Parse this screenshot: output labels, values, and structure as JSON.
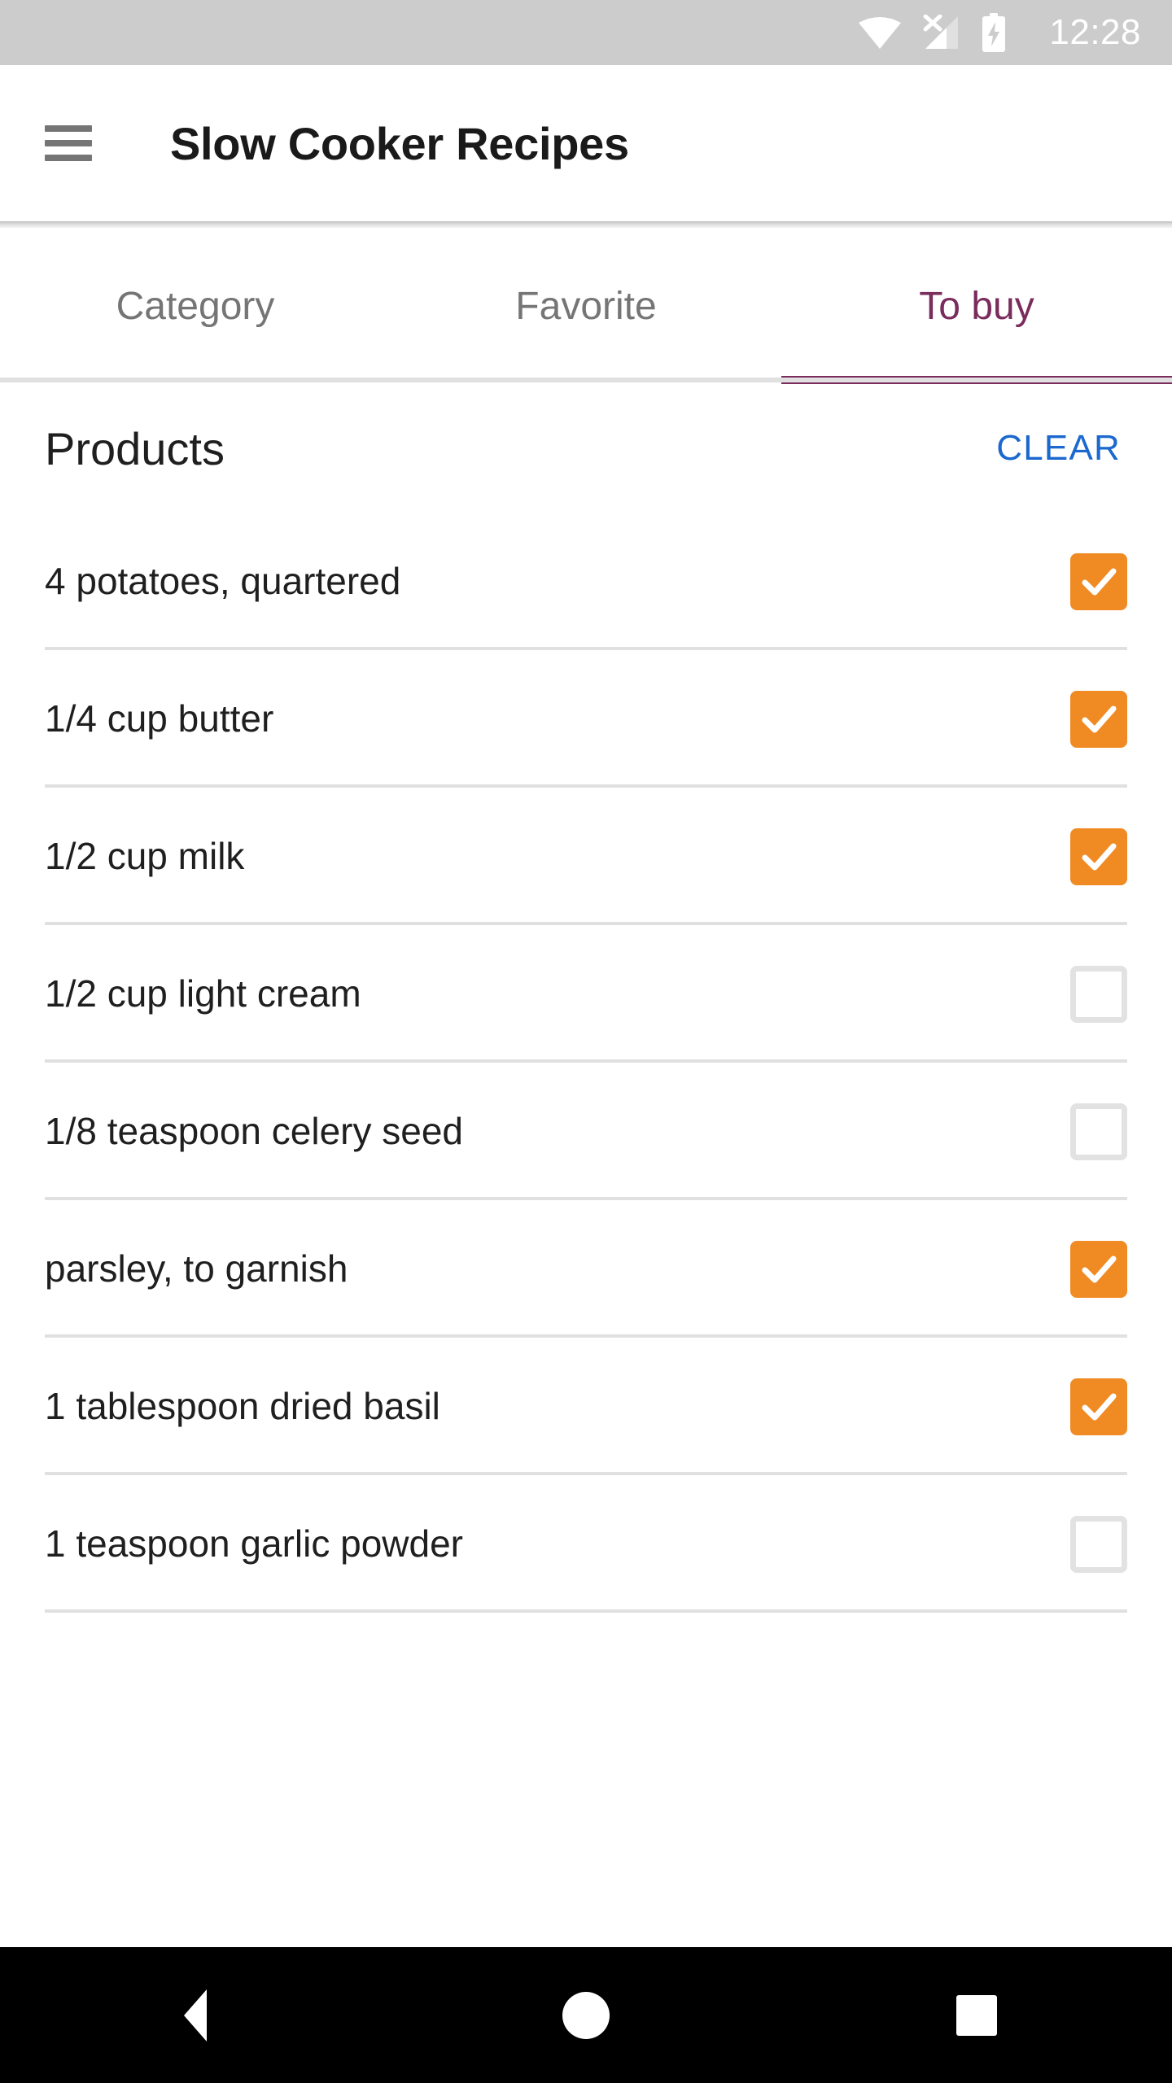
{
  "status_bar": {
    "time": "12:28",
    "icons": [
      "wifi-icon",
      "cellular-no-sim-icon",
      "battery-charging-icon"
    ],
    "background_color": "#CCCCCC"
  },
  "app_bar": {
    "menu_icon": "hamburger-menu-icon",
    "title": "Slow Cooker Recipes"
  },
  "tabs": {
    "active_index": 2,
    "active_color": "#7A2C5C",
    "inactive_color": "#757575",
    "items": [
      {
        "label": "Category",
        "active": false
      },
      {
        "label": "Favorite",
        "active": false
      },
      {
        "label": "To buy",
        "active": true
      }
    ]
  },
  "main": {
    "section_title": "Products",
    "clear_label": "CLEAR",
    "clear_color": "#1B68CF",
    "checkbox_checked_color": "#F08B24",
    "checkbox_unchecked_border_color": "#E2E2E2",
    "products": [
      {
        "label": "4 potatoes, quartered",
        "checked": true
      },
      {
        "label": "1/4 cup butter",
        "checked": true
      },
      {
        "label": "1/2 cup milk",
        "checked": true
      },
      {
        "label": "1/2 cup light cream",
        "checked": false
      },
      {
        "label": "1/8 teaspoon celery seed",
        "checked": false
      },
      {
        "label": "parsley, to garnish",
        "checked": true
      },
      {
        "label": "1 tablespoon dried basil",
        "checked": true
      },
      {
        "label": "1 teaspoon garlic powder",
        "checked": false
      }
    ]
  },
  "nav_bar": {
    "background_color": "#000000",
    "buttons": [
      {
        "name": "back-button",
        "icon": "back-triangle-icon"
      },
      {
        "name": "home-button",
        "icon": "home-circle-icon"
      },
      {
        "name": "recents-button",
        "icon": "recents-square-icon"
      }
    ]
  }
}
